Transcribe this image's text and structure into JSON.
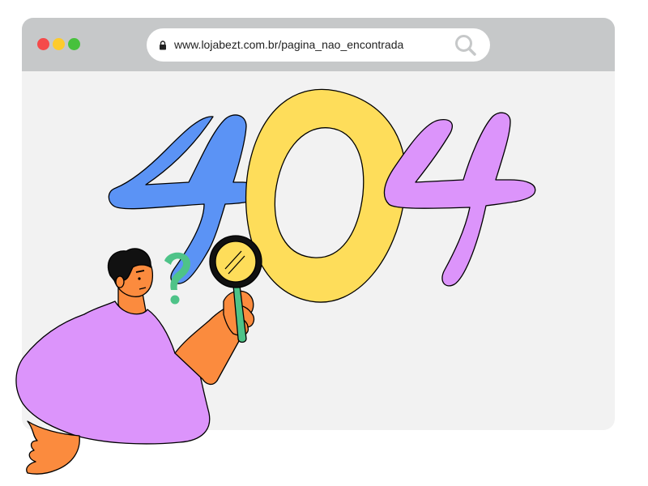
{
  "window": {
    "traffic_lights": {
      "close_color": "#f54a4a",
      "minimize_color": "#fdcb2c",
      "zoom_color": "#47c13c"
    },
    "address_bar": {
      "url": "www.lojabezt.com.br/pagina_nao_encontrada",
      "lock_icon": "lock-icon",
      "search_icon": "search-icon"
    }
  },
  "illustration": {
    "error_code_digits": [
      "4",
      "0",
      "4"
    ],
    "digit_colors": [
      "#5b93f5",
      "#fedd5a",
      "#dc94fb"
    ],
    "question_mark_color": "#4ec388",
    "shirt_color": "#dc94fb",
    "skin_color": "#fb8b3e",
    "magnifier_lens_color": "#fedd5a",
    "magnifier_handle_color": "#4ec388"
  }
}
